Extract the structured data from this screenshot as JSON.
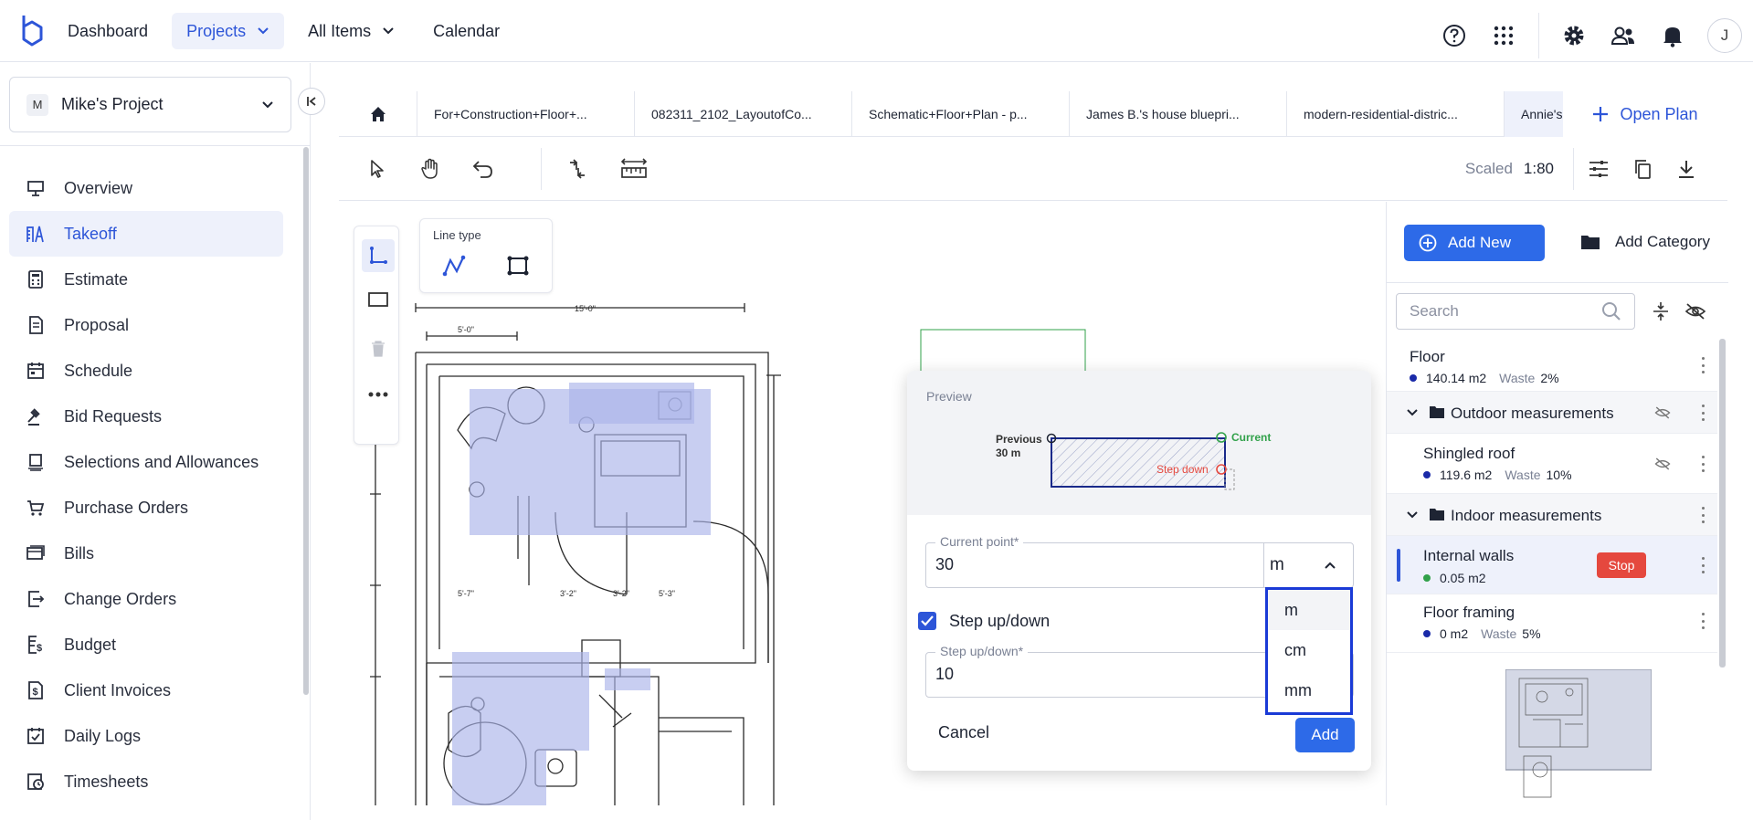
{
  "topnav": {
    "dashboard": "Dashboard",
    "projects": "Projects",
    "all_items": "All Items",
    "calendar": "Calendar",
    "avatar_initial": "J"
  },
  "sidebar": {
    "project_badge": "M",
    "project_name": "Mike's Project",
    "items": [
      {
        "label": "Overview",
        "icon": "monitor-icon"
      },
      {
        "label": "Takeoff",
        "icon": "takeoff-icon"
      },
      {
        "label": "Estimate",
        "icon": "calculator-icon"
      },
      {
        "label": "Proposal",
        "icon": "proposal-icon"
      },
      {
        "label": "Schedule",
        "icon": "calendar-icon"
      },
      {
        "label": "Bid Requests",
        "icon": "gavel-icon"
      },
      {
        "label": "Selections and Allowances",
        "icon": "selections-icon"
      },
      {
        "label": "Purchase Orders",
        "icon": "cart-icon"
      },
      {
        "label": "Bills",
        "icon": "bills-icon"
      },
      {
        "label": "Change Orders",
        "icon": "change-orders-icon"
      },
      {
        "label": "Budget",
        "icon": "budget-icon"
      },
      {
        "label": "Client Invoices",
        "icon": "invoice-icon"
      },
      {
        "label": "Daily Logs",
        "icon": "daily-logs-icon"
      },
      {
        "label": "Timesheets",
        "icon": "timesheet-icon"
      }
    ]
  },
  "tabs": [
    "For+Construction+Floor+...",
    "082311_2102_LayoutofCo...",
    "Schematic+Floor+Plan - p...",
    "James B.'s house bluepri...",
    "modern-residential-distric...",
    "Annie's"
  ],
  "open_plan": "Open Plan",
  "toolbar": {
    "scaled_label": "Scaled",
    "scale_value": "1:80"
  },
  "line_type": {
    "label": "Line type"
  },
  "plan": {
    "dim_top": "15'-0\"",
    "dim_a": "5'-0\"",
    "dim_b": "5'-7\"",
    "dim_c": "3'-2\"",
    "dim_d": "5'-3\"",
    "dim_e": "3'-2\""
  },
  "dialog": {
    "preview_label": "Preview",
    "previous_label": "Previous",
    "previous_value": "30 m",
    "current_label": "Current",
    "step_down_label": "Step down",
    "current_point_label": "Current point*",
    "current_point_value": "30",
    "unit_value": "m",
    "step_checkbox_label": "Step up/down",
    "step_field_label": "Step up/down*",
    "step_field_value": "10",
    "cancel": "Cancel",
    "add": "Add"
  },
  "unit_options": [
    "m",
    "cm",
    "mm"
  ],
  "right_panel": {
    "add_new": "Add New",
    "add_category": "Add Category",
    "search_placeholder": "Search",
    "items": {
      "floor": {
        "title": "Floor",
        "value": "140.14 m2",
        "waste": "Waste",
        "waste_pct": "2%"
      },
      "outdoor": {
        "title": "Outdoor measurements"
      },
      "shingled": {
        "title": "Shingled roof",
        "value": "119.6 m2",
        "waste": "Waste",
        "waste_pct": "10%"
      },
      "indoor": {
        "title": "Indoor measurements"
      },
      "internal": {
        "title": "Internal walls",
        "value": "0.05 m2",
        "stop": "Stop"
      },
      "framing": {
        "title": "Floor framing",
        "value": "0 m2",
        "waste": "Waste",
        "waste_pct": "5%"
      }
    }
  },
  "colors": {
    "accent": "#2d55d8",
    "stop": "#e5483e",
    "highlight": "#aab4ea"
  }
}
